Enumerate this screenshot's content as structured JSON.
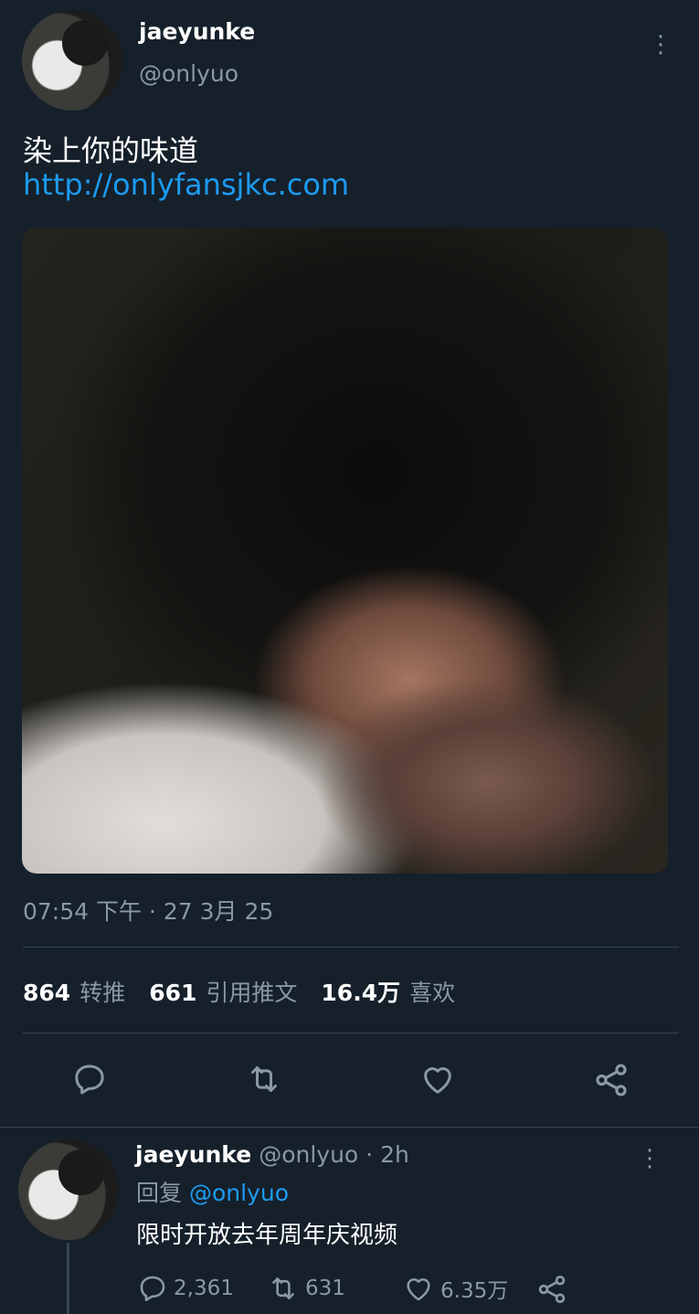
{
  "tweet": {
    "display_name": "jaeyunke",
    "handle": "@onlyuo",
    "text": "染上你的味道",
    "link": "http://onlyfansjkc.com",
    "timestamp": "07:54 下午 · 27 3月 25",
    "stats": {
      "retweets_count": "864",
      "retweets_label": "转推",
      "quotes_count": "661",
      "quotes_label": "引用推文",
      "likes_count": "16.4万",
      "likes_label": "喜欢"
    }
  },
  "actions": {
    "icons": [
      "reply-icon",
      "retweet-icon",
      "like-icon",
      "share-icon"
    ]
  },
  "reply": {
    "display_name": "jaeyunke",
    "handle": "@onlyuo",
    "time": "· 2h",
    "reply_prefix": "回复",
    "reply_to": "@onlyuo",
    "text": "限时开放去年周年庆视频",
    "reply_count": "2,361",
    "retweet_count": "631",
    "like_count": "6.35万"
  },
  "colors": {
    "background": "#15202b",
    "link": "#1d9bf0",
    "muted": "#8b98a5",
    "divider": "#38444d"
  }
}
